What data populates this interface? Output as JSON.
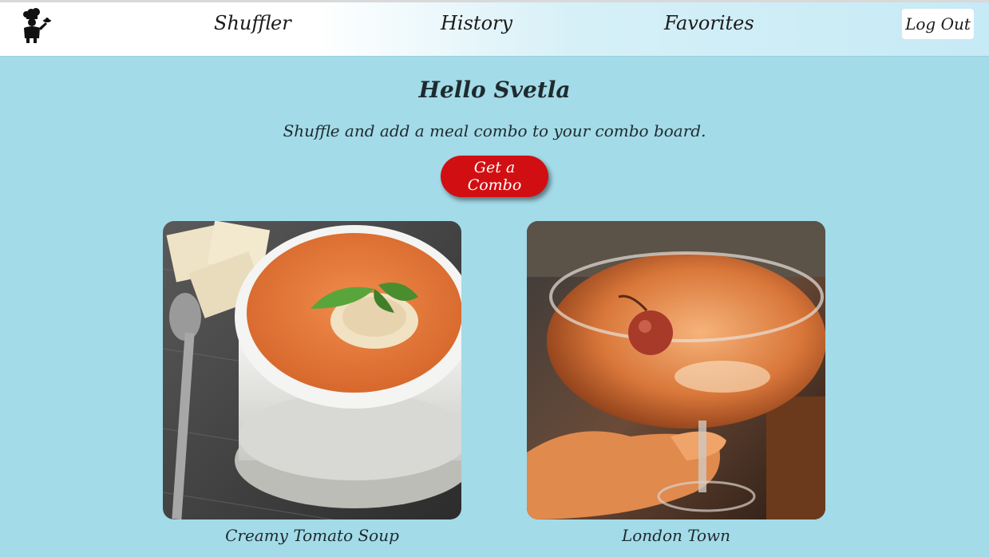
{
  "nav": {
    "logo_icon": "chef-icon",
    "links": [
      {
        "label": "Shuffler"
      },
      {
        "label": "History"
      },
      {
        "label": "Favorites"
      }
    ],
    "logout_label": "Log Out"
  },
  "main": {
    "greeting": "Hello Svetla",
    "subtitle": "Shuffle and add a meal combo to your combo board.",
    "combo_button_label": "Get a Combo"
  },
  "combo": [
    {
      "name": "Creamy Tomato Soup",
      "image": "tomato-soup-photo"
    },
    {
      "name": "London Town",
      "image": "cocktail-photo"
    }
  ],
  "colors": {
    "background": "#a3dbe8",
    "accent_button": "#d10f12"
  }
}
